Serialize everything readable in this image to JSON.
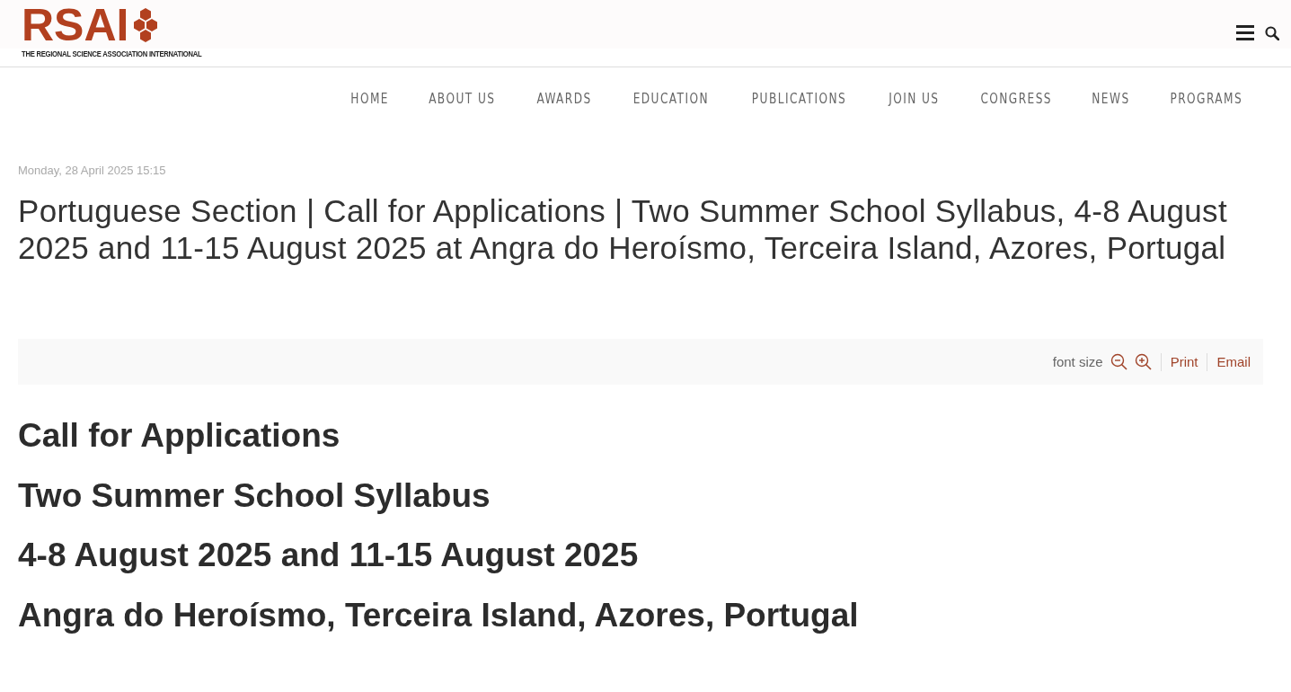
{
  "logo": {
    "mark": "RSAI",
    "tagline": "THE REGIONAL SCIENCE ASSOCIATION INTERNATIONAL"
  },
  "nav": [
    {
      "label": "HOME"
    },
    {
      "label": "ABOUT US"
    },
    {
      "label": "AWARDS"
    },
    {
      "label": "EDUCATION"
    },
    {
      "label": "PUBLICATIONS"
    },
    {
      "label": "JOIN US"
    },
    {
      "label": "CONGRESS"
    },
    {
      "label": "NEWS"
    },
    {
      "label": "PROGRAMS"
    }
  ],
  "article": {
    "date": "Monday, 28 April 2025 15:15",
    "title": "Portuguese Section | Call for Applications | Two Summer School Syllabus, 4-8 August 2025 and 11-15 August 2025 at Angra do Heroísmo, Terceira Island, Azores, Portugal",
    "toolbar": {
      "font_size_label": "font size",
      "links": [
        "Print",
        "Email"
      ]
    },
    "headings": [
      "Call for Applications",
      "Two Summer School Syllabus",
      "4-8 August 2025 and 11-15 August 2025",
      "Angra do Heroísmo, Terceira Island, Azores, Portugal"
    ]
  }
}
